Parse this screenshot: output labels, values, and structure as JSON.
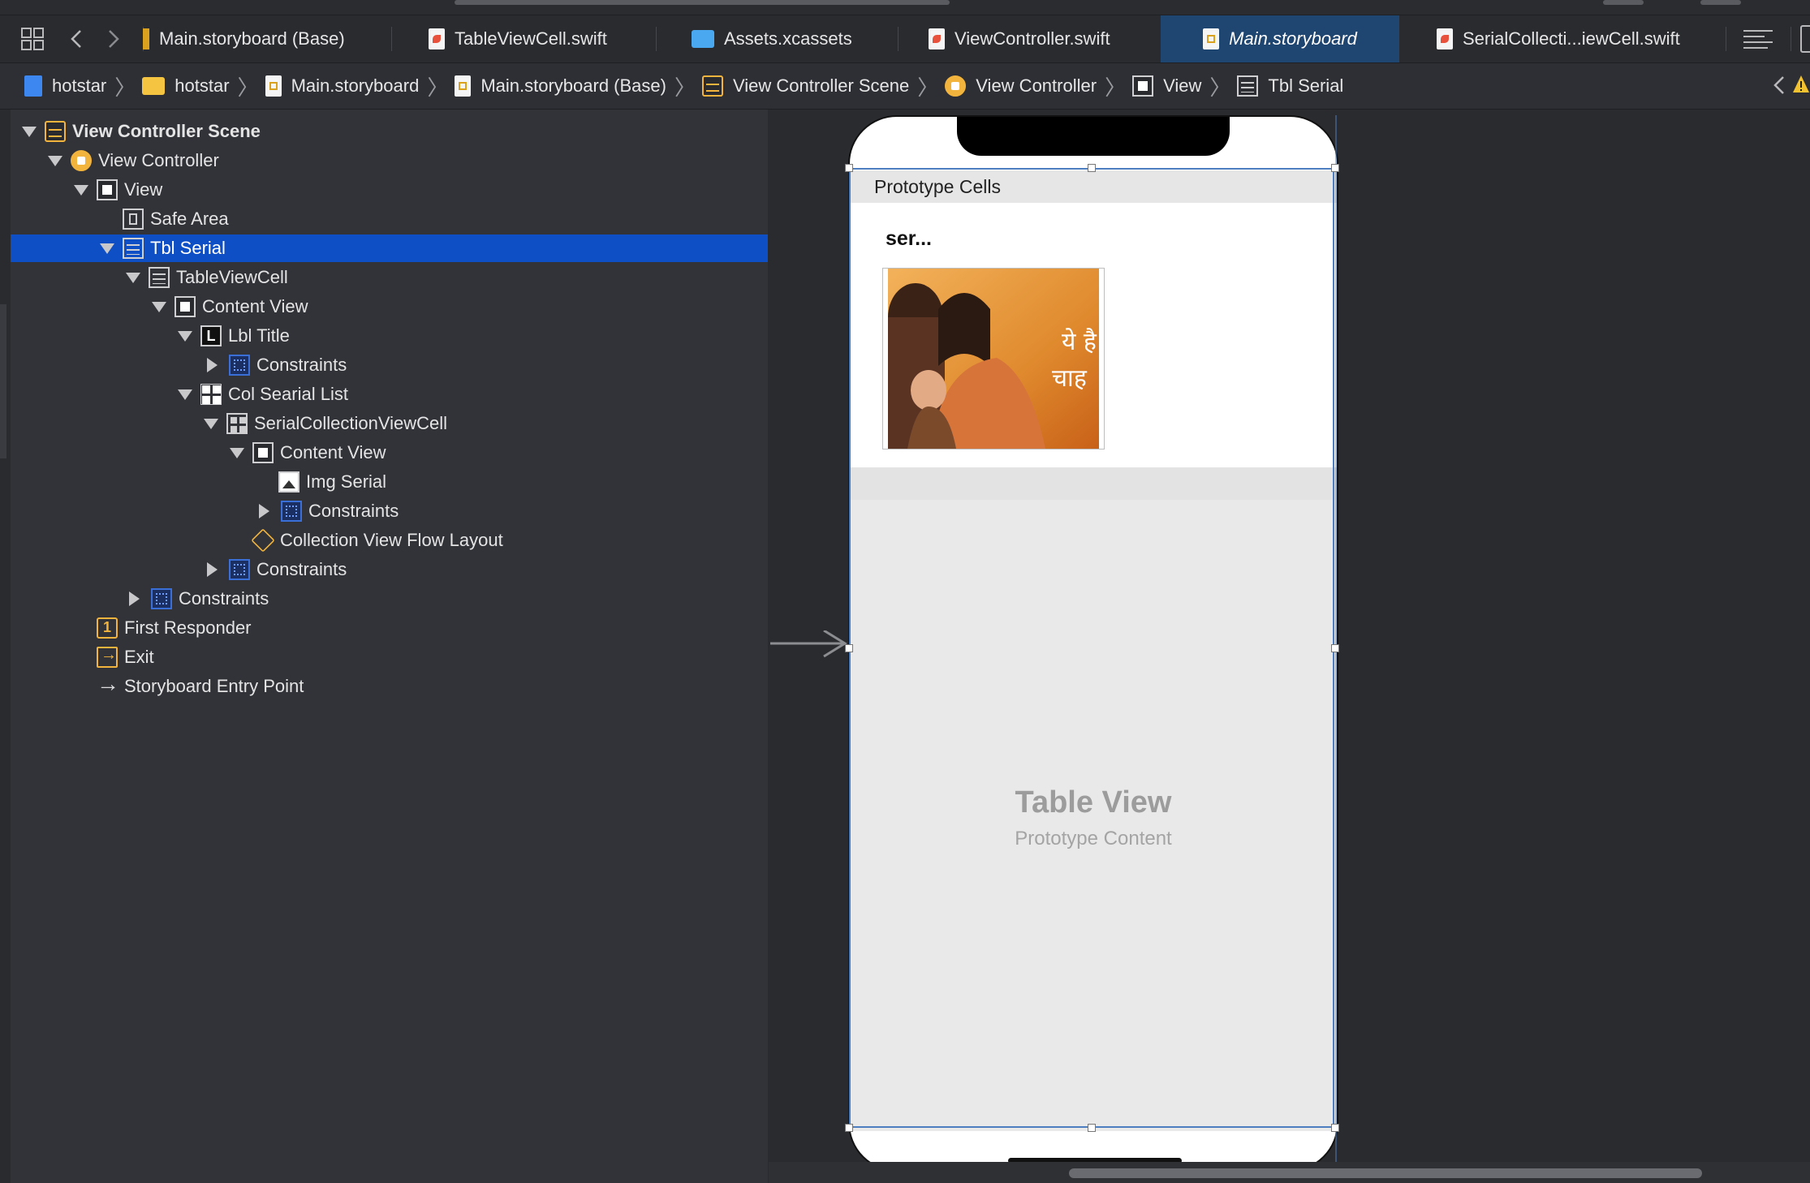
{
  "tabs": [
    {
      "label": "Main.storyboard (Base)",
      "icon": "storyboard-file-icon",
      "active": false
    },
    {
      "label": "TableViewCell.swift",
      "icon": "swift-file-icon",
      "active": false
    },
    {
      "label": "Assets.xcassets",
      "icon": "asset-folder-icon",
      "active": false
    },
    {
      "label": "ViewController.swift",
      "icon": "swift-file-icon",
      "active": false
    },
    {
      "label": "Main.storyboard",
      "icon": "storyboard-file-icon",
      "active": true
    },
    {
      "label": "SerialCollecti...iewCell.swift",
      "icon": "swift-file-icon",
      "active": false
    }
  ],
  "breadcrumb": [
    {
      "label": "hotstar",
      "icon": "project-icon"
    },
    {
      "label": "hotstar",
      "icon": "folder-icon"
    },
    {
      "label": "Main.storyboard",
      "icon": "storyboard-file-icon"
    },
    {
      "label": "Main.storyboard (Base)",
      "icon": "storyboard-file-icon"
    },
    {
      "label": "View Controller Scene",
      "icon": "scene-icon"
    },
    {
      "label": "View Controller",
      "icon": "view-controller-icon"
    },
    {
      "label": "View",
      "icon": "view-icon"
    },
    {
      "label": "Tbl Serial",
      "icon": "table-view-icon"
    }
  ],
  "outline": [
    {
      "label": "View Controller Scene",
      "level": 0,
      "disclosure": "open",
      "icon": "scene-icon",
      "selected": false,
      "bold": true
    },
    {
      "label": "View Controller",
      "level": 1,
      "disclosure": "open",
      "icon": "view-controller-icon",
      "selected": false
    },
    {
      "label": "View",
      "level": 2,
      "disclosure": "open",
      "icon": "view-icon",
      "selected": false
    },
    {
      "label": "Safe Area",
      "level": 3,
      "disclosure": "none",
      "icon": "safe-area-icon",
      "selected": false
    },
    {
      "label": "Tbl Serial",
      "level": 3,
      "disclosure": "open",
      "icon": "table-view-icon",
      "selected": true
    },
    {
      "label": "TableViewCell",
      "level": 4,
      "disclosure": "open",
      "icon": "table-view-icon",
      "selected": false
    },
    {
      "label": "Content View",
      "level": 5,
      "disclosure": "open",
      "icon": "view-icon",
      "selected": false
    },
    {
      "label": "Lbl Title",
      "level": 6,
      "disclosure": "open",
      "icon": "label-icon",
      "selected": false
    },
    {
      "label": "Constraints",
      "level": 7,
      "disclosure": "closed",
      "icon": "constraints-icon",
      "selected": false
    },
    {
      "label": "Col Searial List",
      "level": 6,
      "disclosure": "open",
      "icon": "collection-view-icon",
      "selected": false
    },
    {
      "label": "SerialCollectionViewCell",
      "level": 7,
      "disclosure": "open",
      "icon": "collection-cell-icon",
      "selected": false
    },
    {
      "label": "Content View",
      "level": 8,
      "disclosure": "open",
      "icon": "view-icon",
      "selected": false
    },
    {
      "label": "Img Serial",
      "level": 9,
      "disclosure": "none",
      "icon": "image-view-icon",
      "selected": false
    },
    {
      "label": "Constraints",
      "level": 9,
      "disclosure": "closed",
      "icon": "constraints-icon",
      "selected": false
    },
    {
      "label": "Collection View Flow Layout",
      "level": 8,
      "disclosure": "none",
      "icon": "flow-layout-icon",
      "selected": false
    },
    {
      "label": "Constraints",
      "level": 7,
      "disclosure": "closed",
      "icon": "constraints-icon",
      "selected": false
    },
    {
      "label": "Constraints",
      "level": 4,
      "disclosure": "closed",
      "icon": "constraints-icon",
      "selected": false
    },
    {
      "label": "First Responder",
      "level": 2,
      "disclosure": "none",
      "icon": "first-responder-icon",
      "selected": false
    },
    {
      "label": "Exit",
      "level": 2,
      "disclosure": "none",
      "icon": "exit-icon",
      "selected": false
    },
    {
      "label": "Storyboard Entry Point",
      "level": 2,
      "disclosure": "none",
      "icon": "entry-arrow-icon",
      "selected": false
    }
  ],
  "canvas": {
    "prototype_header": "Prototype Cells",
    "cell_title": "ser...",
    "image_caption": "ये है चाह",
    "placeholder_title": "Table View",
    "placeholder_subtitle": "Prototype Content"
  },
  "colors": {
    "selection": "#0f4fc6",
    "active_tab": "#1f4571",
    "accent_icon": "#f2b43c",
    "constraint_icon": "#3b6fd8"
  }
}
